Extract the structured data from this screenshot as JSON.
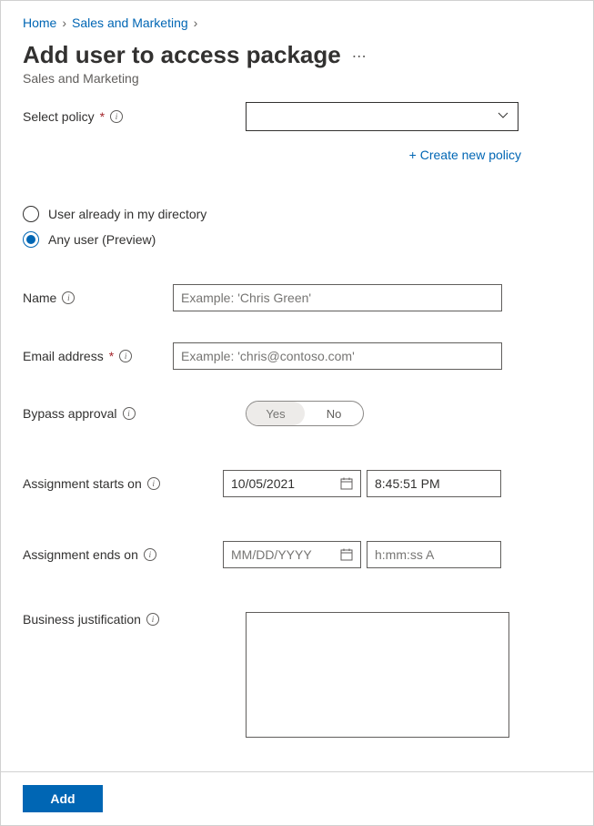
{
  "breadcrumb": {
    "home": "Home",
    "section": "Sales and Marketing"
  },
  "page": {
    "title": "Add user to access package",
    "subtitle": "Sales and Marketing"
  },
  "policy": {
    "label": "Select policy",
    "create_link": "+ Create new policy"
  },
  "userType": {
    "option1": "User already in my directory",
    "option2": "Any user (Preview)",
    "selected": "option2"
  },
  "name": {
    "label": "Name",
    "placeholder": "Example: 'Chris Green'",
    "value": ""
  },
  "email": {
    "label": "Email address",
    "placeholder": "Example: 'chris@contoso.com'",
    "value": ""
  },
  "bypass": {
    "label": "Bypass approval",
    "yes": "Yes",
    "no": "No",
    "selected": "yes"
  },
  "starts": {
    "label": "Assignment starts on",
    "date": "10/05/2021",
    "time": "8:45:51 PM"
  },
  "ends": {
    "label": "Assignment ends on",
    "date_placeholder": "MM/DD/YYYY",
    "time_placeholder": "h:mm:ss A"
  },
  "justification": {
    "label": "Business justification",
    "value": ""
  },
  "footer": {
    "add": "Add"
  }
}
